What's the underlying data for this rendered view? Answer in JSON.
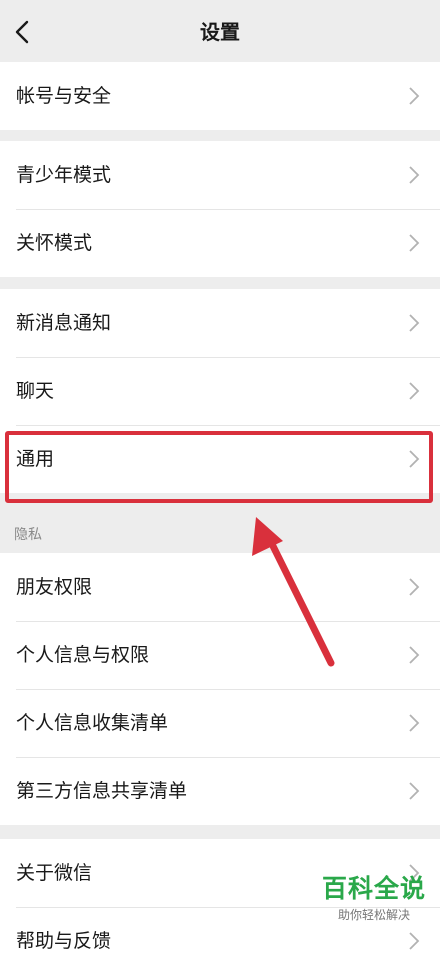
{
  "header": {
    "title": "设置"
  },
  "groups": [
    {
      "items": [
        {
          "label": "帐号与安全"
        }
      ]
    },
    {
      "items": [
        {
          "label": "青少年模式"
        },
        {
          "label": "关怀模式"
        }
      ]
    },
    {
      "items": [
        {
          "label": "新消息通知"
        },
        {
          "label": "聊天"
        },
        {
          "label": "通用"
        }
      ]
    },
    {
      "section_label": "隐私",
      "items": [
        {
          "label": "朋友权限"
        },
        {
          "label": "个人信息与权限"
        },
        {
          "label": "个人信息收集清单"
        },
        {
          "label": "第三方信息共享清单"
        }
      ]
    },
    {
      "items": [
        {
          "label": "关于微信"
        },
        {
          "label": "帮助与反馈"
        }
      ]
    }
  ],
  "annotation": {
    "highlighted_item": "通用",
    "color": "#d9303c"
  },
  "watermark": {
    "title": "百科全说",
    "subtitle": "助你轻松解决"
  }
}
